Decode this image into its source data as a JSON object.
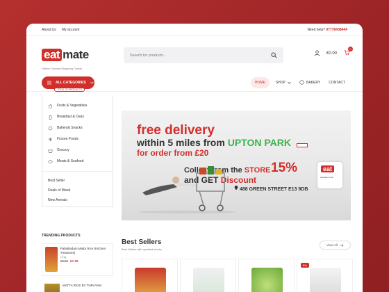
{
  "topbar": {
    "about_label": "About Us",
    "account_label": "My account",
    "help_prefix": "Need help?",
    "phone": "07776438444"
  },
  "header": {
    "logo_eat": "eat",
    "logo_mate": "mate",
    "tagline": "Online Grocery Shopping Center",
    "search_placeholder": "Search for products...",
    "cart_total": "£0.00",
    "cart_count": "0"
  },
  "nav": {
    "all_categories": "ALL CATEGORIES",
    "total_products": "TOTAL 20 PRODUCTS",
    "items": [
      "HOME",
      "SHOP",
      "BAKERY",
      "CONTACT"
    ]
  },
  "sidebar": {
    "categories": [
      "Fruits & Vegetables",
      "Breakfast & Dairy",
      "Bakery& Snacks",
      "Frozen Foods",
      "Grocery",
      "Meats & Seafood"
    ],
    "links": [
      "Best Seller",
      "Deals of Week",
      "New Arrivals"
    ]
  },
  "banner": {
    "line1": "free delivery",
    "line2_a": "within 5 miles from ",
    "line2_b": "UPTON PARK",
    "line3": "for order from £20",
    "line4_a": "Collect from the ",
    "line4_b": "STORE",
    "line5_a": "and GET",
    "line5_b": "Discount",
    "percent": "15%",
    "address": "488 GREEN STREET E13 9DB",
    "bag_logo": "eat",
    "bag_site": "eatmate.co.uk"
  },
  "trending": {
    "title": "TRENDING PRODUCTS",
    "products": [
      {
        "name": "Palakkadam Matta Rice (Kitchen Treasures)",
        "weight": "10 kg",
        "old_price": "£8.60",
        "new_price": "£7.39"
      },
      {
        "name": "MATTA RICE BY THRAYAM",
        "weight": "",
        "old_price": "",
        "new_price": ""
      }
    ]
  },
  "best_sellers": {
    "title": "Best Sellers",
    "subtitle": "Best Sellers with updated stocks .",
    "view_all": "View All",
    "badge": "8%"
  },
  "colors": {
    "brand_red": "#d12f2c",
    "green": "#3bb44a"
  }
}
